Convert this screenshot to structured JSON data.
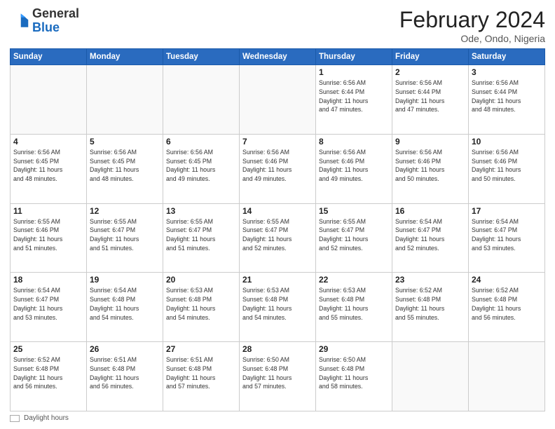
{
  "logo": {
    "general": "General",
    "blue": "Blue"
  },
  "header": {
    "month": "February 2024",
    "location": "Ode, Ondo, Nigeria"
  },
  "weekdays": [
    "Sunday",
    "Monday",
    "Tuesday",
    "Wednesday",
    "Thursday",
    "Friday",
    "Saturday"
  ],
  "legend": {
    "label": "Daylight hours"
  },
  "weeks": [
    [
      {
        "day": "",
        "info": ""
      },
      {
        "day": "",
        "info": ""
      },
      {
        "day": "",
        "info": ""
      },
      {
        "day": "",
        "info": ""
      },
      {
        "day": "1",
        "info": "Sunrise: 6:56 AM\nSunset: 6:44 PM\nDaylight: 11 hours\nand 47 minutes."
      },
      {
        "day": "2",
        "info": "Sunrise: 6:56 AM\nSunset: 6:44 PM\nDaylight: 11 hours\nand 47 minutes."
      },
      {
        "day": "3",
        "info": "Sunrise: 6:56 AM\nSunset: 6:44 PM\nDaylight: 11 hours\nand 48 minutes."
      }
    ],
    [
      {
        "day": "4",
        "info": "Sunrise: 6:56 AM\nSunset: 6:45 PM\nDaylight: 11 hours\nand 48 minutes."
      },
      {
        "day": "5",
        "info": "Sunrise: 6:56 AM\nSunset: 6:45 PM\nDaylight: 11 hours\nand 48 minutes."
      },
      {
        "day": "6",
        "info": "Sunrise: 6:56 AM\nSunset: 6:45 PM\nDaylight: 11 hours\nand 49 minutes."
      },
      {
        "day": "7",
        "info": "Sunrise: 6:56 AM\nSunset: 6:46 PM\nDaylight: 11 hours\nand 49 minutes."
      },
      {
        "day": "8",
        "info": "Sunrise: 6:56 AM\nSunset: 6:46 PM\nDaylight: 11 hours\nand 49 minutes."
      },
      {
        "day": "9",
        "info": "Sunrise: 6:56 AM\nSunset: 6:46 PM\nDaylight: 11 hours\nand 50 minutes."
      },
      {
        "day": "10",
        "info": "Sunrise: 6:56 AM\nSunset: 6:46 PM\nDaylight: 11 hours\nand 50 minutes."
      }
    ],
    [
      {
        "day": "11",
        "info": "Sunrise: 6:55 AM\nSunset: 6:46 PM\nDaylight: 11 hours\nand 51 minutes."
      },
      {
        "day": "12",
        "info": "Sunrise: 6:55 AM\nSunset: 6:47 PM\nDaylight: 11 hours\nand 51 minutes."
      },
      {
        "day": "13",
        "info": "Sunrise: 6:55 AM\nSunset: 6:47 PM\nDaylight: 11 hours\nand 51 minutes."
      },
      {
        "day": "14",
        "info": "Sunrise: 6:55 AM\nSunset: 6:47 PM\nDaylight: 11 hours\nand 52 minutes."
      },
      {
        "day": "15",
        "info": "Sunrise: 6:55 AM\nSunset: 6:47 PM\nDaylight: 11 hours\nand 52 minutes."
      },
      {
        "day": "16",
        "info": "Sunrise: 6:54 AM\nSunset: 6:47 PM\nDaylight: 11 hours\nand 52 minutes."
      },
      {
        "day": "17",
        "info": "Sunrise: 6:54 AM\nSunset: 6:47 PM\nDaylight: 11 hours\nand 53 minutes."
      }
    ],
    [
      {
        "day": "18",
        "info": "Sunrise: 6:54 AM\nSunset: 6:47 PM\nDaylight: 11 hours\nand 53 minutes."
      },
      {
        "day": "19",
        "info": "Sunrise: 6:54 AM\nSunset: 6:48 PM\nDaylight: 11 hours\nand 54 minutes."
      },
      {
        "day": "20",
        "info": "Sunrise: 6:53 AM\nSunset: 6:48 PM\nDaylight: 11 hours\nand 54 minutes."
      },
      {
        "day": "21",
        "info": "Sunrise: 6:53 AM\nSunset: 6:48 PM\nDaylight: 11 hours\nand 54 minutes."
      },
      {
        "day": "22",
        "info": "Sunrise: 6:53 AM\nSunset: 6:48 PM\nDaylight: 11 hours\nand 55 minutes."
      },
      {
        "day": "23",
        "info": "Sunrise: 6:52 AM\nSunset: 6:48 PM\nDaylight: 11 hours\nand 55 minutes."
      },
      {
        "day": "24",
        "info": "Sunrise: 6:52 AM\nSunset: 6:48 PM\nDaylight: 11 hours\nand 56 minutes."
      }
    ],
    [
      {
        "day": "25",
        "info": "Sunrise: 6:52 AM\nSunset: 6:48 PM\nDaylight: 11 hours\nand 56 minutes."
      },
      {
        "day": "26",
        "info": "Sunrise: 6:51 AM\nSunset: 6:48 PM\nDaylight: 11 hours\nand 56 minutes."
      },
      {
        "day": "27",
        "info": "Sunrise: 6:51 AM\nSunset: 6:48 PM\nDaylight: 11 hours\nand 57 minutes."
      },
      {
        "day": "28",
        "info": "Sunrise: 6:50 AM\nSunset: 6:48 PM\nDaylight: 11 hours\nand 57 minutes."
      },
      {
        "day": "29",
        "info": "Sunrise: 6:50 AM\nSunset: 6:48 PM\nDaylight: 11 hours\nand 58 minutes."
      },
      {
        "day": "",
        "info": ""
      },
      {
        "day": "",
        "info": ""
      }
    ]
  ]
}
